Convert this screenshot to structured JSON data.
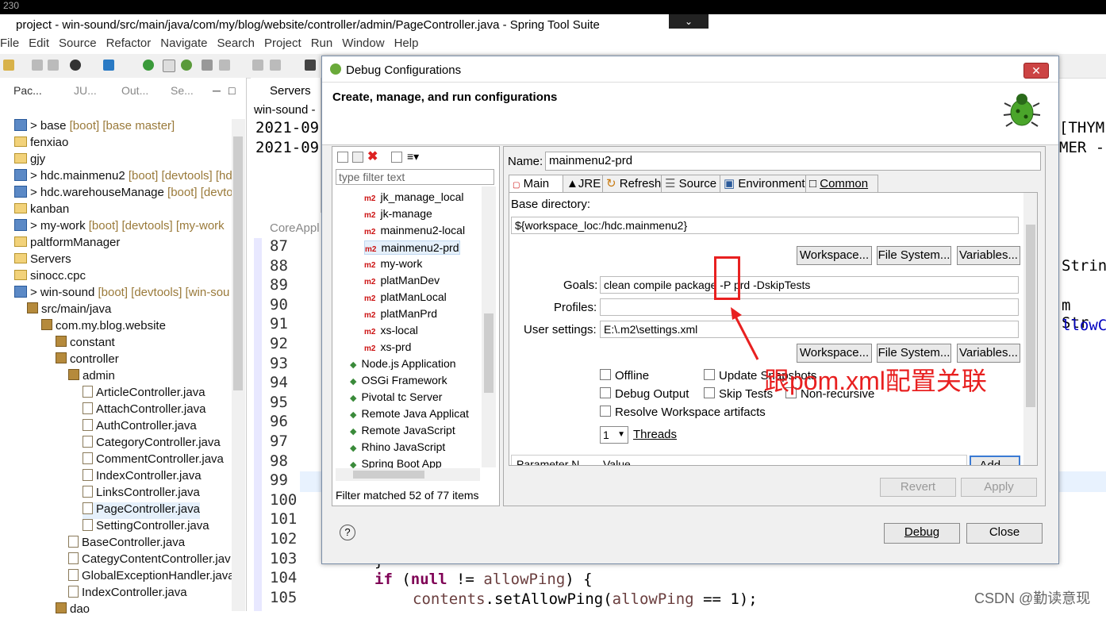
{
  "window": {
    "title": "project - win-sound/src/main/java/com/my/blog/website/controller/admin/PageController.java - Spring Tool Suite",
    "top_tab": "230"
  },
  "menu": [
    "File",
    "Edit",
    "Source",
    "Refactor",
    "Navigate",
    "Search",
    "Project",
    "Run",
    "Window",
    "Help"
  ],
  "explorer": {
    "tabs": [
      "Pac...",
      "JU...",
      "Out...",
      "Se..."
    ],
    "rows": [
      {
        "label": "> base",
        "tag": " [boot] [base master]",
        "icon": "project-icon",
        "indent": 18
      },
      {
        "label": "fenxiao",
        "tag": "",
        "icon": "folder-icon",
        "indent": 18
      },
      {
        "label": "gjy",
        "tag": "",
        "icon": "folder-icon",
        "indent": 18
      },
      {
        "label": "> hdc.mainmenu2",
        "tag": " [boot] [devtools] [hd",
        "icon": "project-icon",
        "indent": 18
      },
      {
        "label": "> hdc.warehouseManage",
        "tag": " [boot] [devto",
        "icon": "project-icon",
        "indent": 18
      },
      {
        "label": "kanban",
        "tag": "",
        "icon": "folder-icon",
        "indent": 18
      },
      {
        "label": "> my-work",
        "tag": " [boot] [devtools] [my-work",
        "icon": "project-icon",
        "indent": 18
      },
      {
        "label": "paltformManager",
        "tag": "",
        "icon": "folder-icon",
        "indent": 18
      },
      {
        "label": "Servers",
        "tag": "",
        "icon": "folder-icon",
        "indent": 18
      },
      {
        "label": "sinocc.cpc",
        "tag": "",
        "icon": "folder-icon",
        "indent": 18
      },
      {
        "label": "> win-sound",
        "tag": " [boot] [devtools] [win-sou",
        "icon": "project-icon",
        "indent": 18
      },
      {
        "label": "src/main/java",
        "tag": "",
        "icon": "package-icon",
        "indent": 34
      },
      {
        "label": "com.my.blog.website",
        "tag": "",
        "icon": "package-icon",
        "indent": 52
      },
      {
        "label": "constant",
        "tag": "",
        "icon": "package-icon",
        "indent": 70
      },
      {
        "label": "controller",
        "tag": "",
        "icon": "package-icon",
        "indent": 70
      },
      {
        "label": "admin",
        "tag": "",
        "icon": "package-icon",
        "indent": 86
      },
      {
        "label": "ArticleController.java",
        "tag": "",
        "icon": "java-file-icon",
        "indent": 104
      },
      {
        "label": "AttachController.java",
        "tag": "",
        "icon": "java-file-icon",
        "indent": 104
      },
      {
        "label": "AuthController.java",
        "tag": "",
        "icon": "java-file-icon",
        "indent": 104
      },
      {
        "label": "CategoryController.java",
        "tag": "",
        "icon": "java-file-icon",
        "indent": 104
      },
      {
        "label": "CommentController.java",
        "tag": "",
        "icon": "java-file-icon",
        "indent": 104
      },
      {
        "label": "IndexController.java",
        "tag": "",
        "icon": "java-file-icon",
        "indent": 104
      },
      {
        "label": "LinksController.java",
        "tag": "",
        "icon": "java-file-icon",
        "indent": 104
      },
      {
        "label": "PageController.java",
        "tag": "",
        "icon": "java-file-icon",
        "indent": 104
      },
      {
        "label": "SettingController.java",
        "tag": "",
        "icon": "java-file-icon",
        "indent": 104
      },
      {
        "label": "BaseController.java",
        "tag": "",
        "icon": "java-file-icon",
        "indent": 86
      },
      {
        "label": "CategyContentController.jav",
        "tag": "",
        "icon": "java-file-icon",
        "indent": 86
      },
      {
        "label": "GlobalExceptionHandler.java",
        "tag": "",
        "icon": "java-file-icon",
        "indent": 86
      },
      {
        "label": "IndexController.java",
        "tag": "",
        "icon": "java-file-icon",
        "indent": 86
      },
      {
        "label": "dao",
        "tag": "",
        "icon": "package-icon",
        "indent": 70
      }
    ]
  },
  "servers_view": {
    "tab": "Servers",
    "row1": "win-sound -",
    "log1": "2021-09",
    "log2": "2021-09",
    "core_tab": "CoreAppl"
  },
  "editor": {
    "line_numbers": [
      "87",
      "88",
      "89",
      "90",
      "91",
      "92",
      "93",
      "94",
      "95",
      "96",
      "97",
      "98",
      "99",
      "100",
      "101",
      "102",
      "103",
      "104",
      "105"
    ],
    "right_fragments": [
      "[THYME",
      "MER -",
      "Strin",
      "m Str",
      "llowC"
    ],
    "code_line_104": "if (null != allowPing) {",
    "code_line_105": "contents.setAllowPing(allowPing == 1);",
    "code_line_103": "}"
  },
  "dialog": {
    "title": "Debug Configurations",
    "header": "Create, manage, and run configurations",
    "filter_placeholder": "type filter text",
    "configs": [
      {
        "label": "jk_manage_local",
        "m2": true
      },
      {
        "label": "jk-manage",
        "m2": true
      },
      {
        "label": "mainmenu2-local",
        "m2": true
      },
      {
        "label": "mainmenu2-prd",
        "m2": true,
        "selected": true
      },
      {
        "label": "my-work",
        "m2": true
      },
      {
        "label": "platManDev",
        "m2": true
      },
      {
        "label": "platManLocal",
        "m2": true
      },
      {
        "label": "platManPrd",
        "m2": true
      },
      {
        "label": "xs-local",
        "m2": true
      },
      {
        "label": "xs-prd",
        "m2": true
      },
      {
        "label": "Node.js Application",
        "m2": false
      },
      {
        "label": "OSGi Framework",
        "m2": false
      },
      {
        "label": "Pivotal tc Server",
        "m2": false
      },
      {
        "label": "Remote Java Applicat",
        "m2": false
      },
      {
        "label": "Remote JavaScript",
        "m2": false
      },
      {
        "label": "Rhino JavaScript",
        "m2": false
      },
      {
        "label": "Spring Boot App",
        "m2": false
      }
    ],
    "filter_status": "Filter matched 52 of 77 items",
    "name_label": "Name:",
    "name_value": "mainmenu2-prd",
    "tabs": [
      "Main",
      "JRE",
      "Refresh",
      "Source",
      "Environment",
      "Common"
    ],
    "base_dir_label": "Base directory:",
    "base_dir_value": "${workspace_loc:/hdc.mainmenu2}",
    "workspace_btn": "Workspace...",
    "filesystem_btn": "File System...",
    "variables_btn": "Variables...",
    "goals_label": "Goals:",
    "goals_value": "clean compile package -P prd -DskipTests",
    "profiles_label": "Profiles:",
    "profiles_value": "",
    "user_settings_label": "User settings:",
    "user_settings_value": "E:\\.m2\\settings.xml",
    "checks": {
      "offline": "Offline",
      "update_snapshots": "Update Snapshots",
      "debug_output": "Debug Output",
      "skip_tests": "Skip Tests",
      "non_recursive": "Non-recursive",
      "resolve_workspace": "Resolve Workspace artifacts"
    },
    "threads_value": "1",
    "threads_label": "Threads",
    "param_col1": "Parameter N...",
    "param_col2": "Value",
    "add_btn": "Add...",
    "revert_btn": "Revert",
    "apply_btn": "Apply",
    "debug_btn": "Debug",
    "close_btn": "Close",
    "help": "?"
  },
  "annotation": "跟pom.xml配置关联",
  "watermark": "CSDN @勤读意现",
  "colors": {
    "annotation_red": "#e82020",
    "m2_red": "#cc1111"
  }
}
